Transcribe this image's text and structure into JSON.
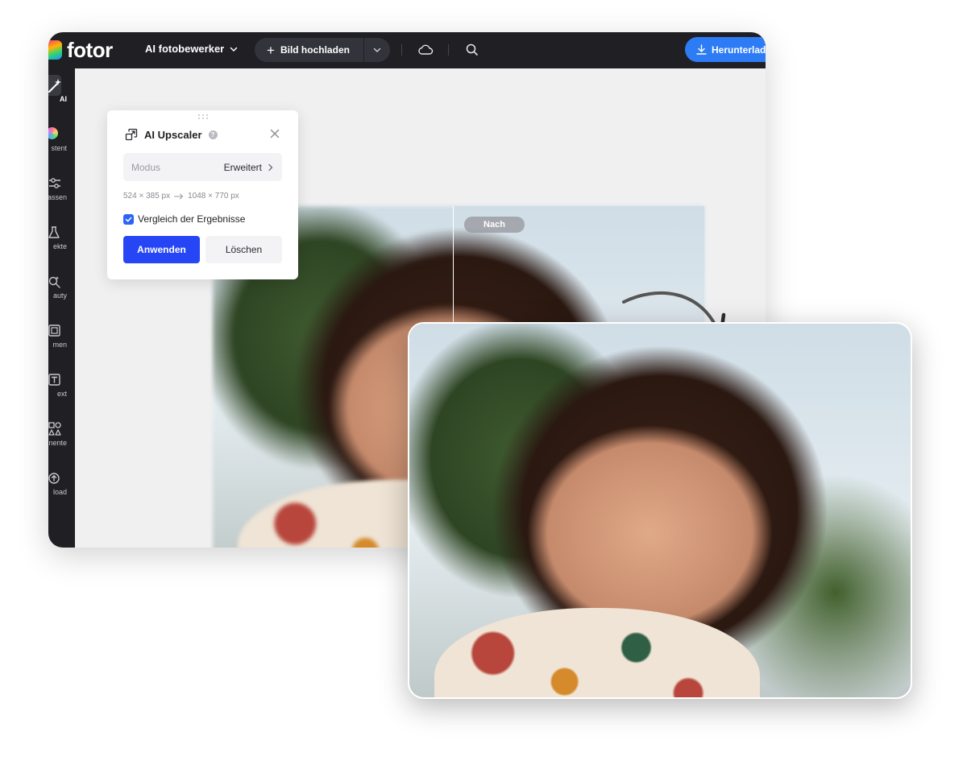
{
  "app": {
    "logo_text": "fotor"
  },
  "topbar": {
    "menu_label": "AI fotobewerker",
    "upload_label": "Bild hochladen",
    "download_label": "Herunterladen"
  },
  "sidebar": {
    "items": [
      {
        "label": "AI",
        "icon": "magic-wand-icon"
      },
      {
        "label": "stent",
        "icon": "assistant-icon"
      },
      {
        "label": "assen",
        "icon": "adjust-icon"
      },
      {
        "label": "ekte",
        "icon": "effects-icon"
      },
      {
        "label": "auty",
        "icon": "beauty-icon"
      },
      {
        "label": "men",
        "icon": "frames-icon"
      },
      {
        "label": "ext",
        "icon": "text-icon"
      },
      {
        "label": "nente",
        "icon": "elements-icon"
      },
      {
        "label": "load",
        "icon": "upload-icon"
      }
    ]
  },
  "panel": {
    "title": "AI Upscaler",
    "mode_label": "Modus",
    "mode_value": "Erweitert",
    "size_from": "524 × 385 px",
    "size_to": "1048 × 770 px",
    "compare_label": "Vergleich der Ergebnisse",
    "compare_checked": true,
    "apply_label": "Anwenden",
    "delete_label": "Löschen"
  },
  "canvas": {
    "after_badge": "Nach"
  },
  "colors": {
    "topbar_bg": "#1f1f24",
    "accent_blue": "#2646f5",
    "download_blue": "#2d7cf6"
  }
}
